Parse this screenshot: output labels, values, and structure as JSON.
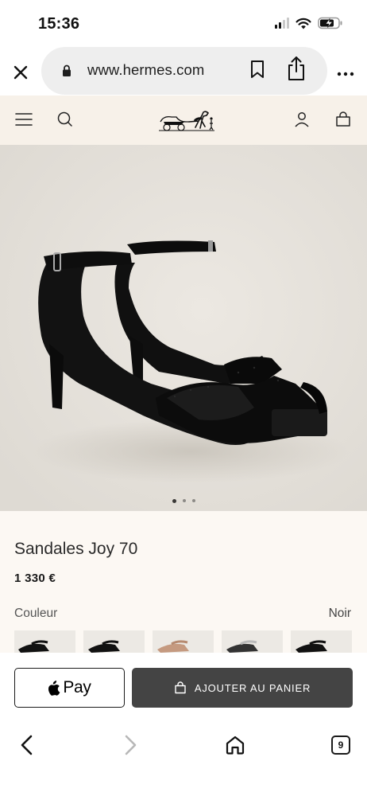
{
  "status_bar": {
    "time": "15:36"
  },
  "browser": {
    "url": "www.hermes.com",
    "icons": [
      "close-icon",
      "lock-icon",
      "bookmark-icon",
      "share-icon",
      "more-icon"
    ]
  },
  "site_header": {
    "icons": [
      "menu-icon",
      "search-icon",
      "hermes-logo",
      "account-icon",
      "bag-icon"
    ]
  },
  "gallery": {
    "image": "black suede sandals product photo",
    "dots_total": 3,
    "dot_active": 1
  },
  "product": {
    "name": "Sandales Joy 70",
    "price": "1 330 €",
    "color_label": "Couleur",
    "color_value": "Noir",
    "swatches": [
      "black",
      "black",
      "tan",
      "silver",
      "black"
    ]
  },
  "actions": {
    "apple_pay_label": "Pay",
    "add_to_cart_label": "AJOUTER AU PANIER"
  },
  "toolbar": {
    "tabs_count": "9",
    "icons": [
      "back-icon",
      "forward-icon",
      "home-icon",
      "tabs-icon"
    ]
  },
  "colors": {
    "header_bg": "#f7f1e9",
    "info_bg": "#fcf8f3",
    "image_bg": "#e8e4de",
    "cart_button": "#444444"
  }
}
